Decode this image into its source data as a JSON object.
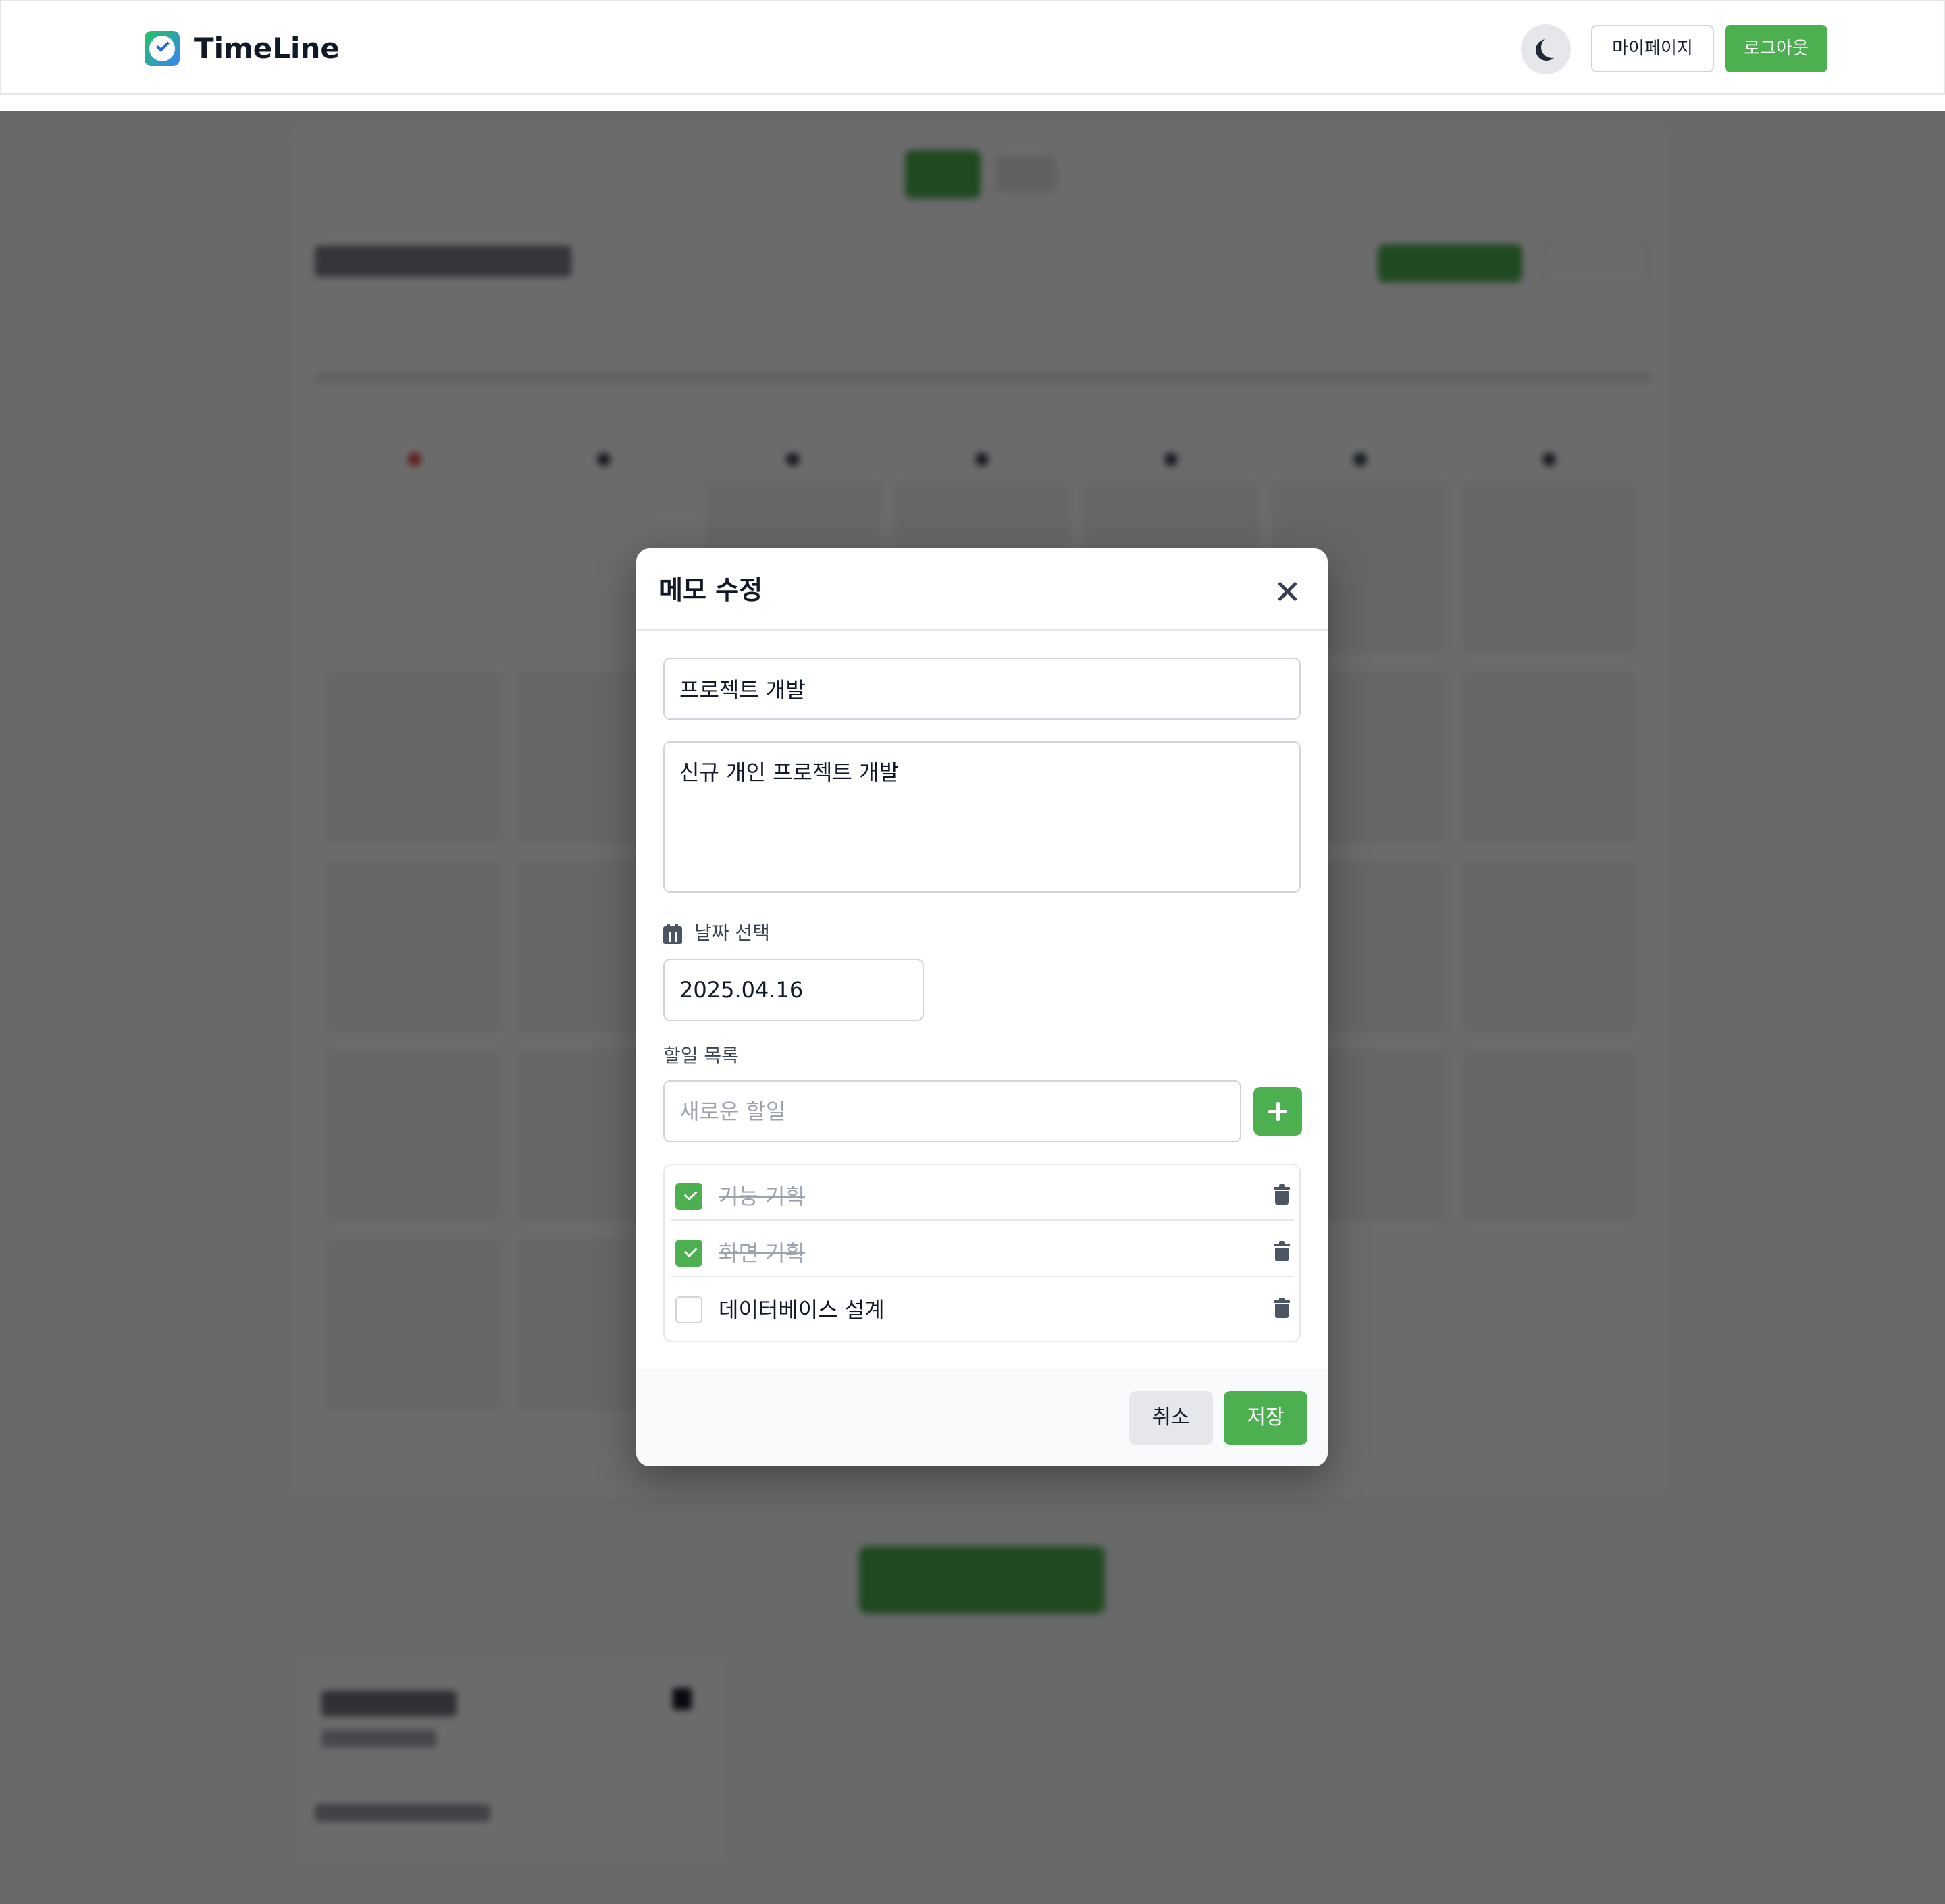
{
  "header": {
    "brand": "TimeLine",
    "theme_toggle_icon": "moon-icon",
    "mypage_label": "마이페이지",
    "logout_label": "로그아웃"
  },
  "modal": {
    "title": "메모 수정",
    "title_value": "프로젝트 개발",
    "description_value": "신규 개인 프로젝트 개발",
    "date_label": "날짜 선택",
    "date_value": "2025.04.16",
    "todo_label": "할일 목록",
    "todo_placeholder": "새로운 할일",
    "todos": [
      {
        "text": "기능 기획",
        "done": true
      },
      {
        "text": "화면 기획",
        "done": true
      },
      {
        "text": "데이터베이스 설계",
        "done": false
      }
    ],
    "cancel_label": "취소",
    "save_label": "저장"
  },
  "colors": {
    "accent": "#4caf50",
    "overlay": "rgba(0,0,0,0.58)"
  }
}
